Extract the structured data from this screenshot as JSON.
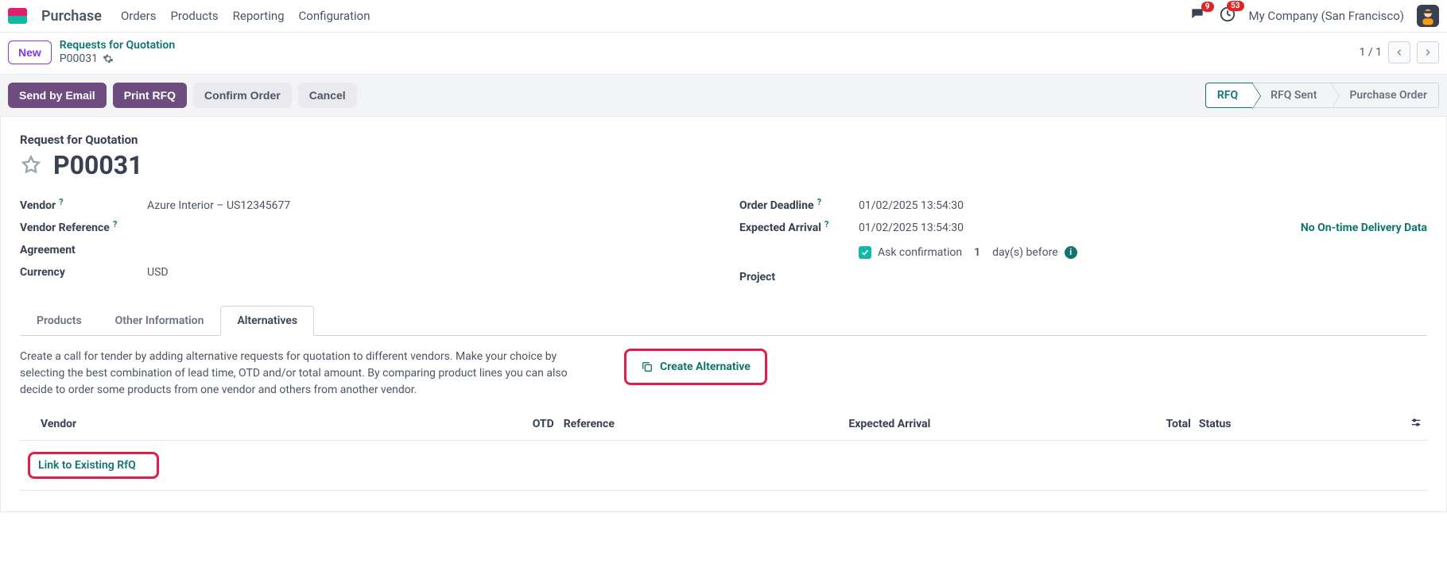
{
  "nav": {
    "app": "Purchase",
    "links": [
      "Orders",
      "Products",
      "Reporting",
      "Configuration"
    ],
    "messages_badge": "9",
    "activities_badge": "53",
    "company": "My Company (San Francisco)"
  },
  "crumbs": {
    "new": "New",
    "parent": "Requests for Quotation",
    "id": "P00031",
    "pager": "1 / 1"
  },
  "actions": {
    "send_email": "Send by Email",
    "print_rfq": "Print RFQ",
    "confirm": "Confirm Order",
    "cancel": "Cancel"
  },
  "status_steps": {
    "rfq": "RFQ",
    "rfq_sent": "RFQ Sent",
    "po": "Purchase Order"
  },
  "sheet": {
    "title_small": "Request for Quotation",
    "title": "P00031",
    "left": {
      "vendor_label": "Vendor",
      "vendor_value": "Azure Interior – US12345677",
      "vendor_ref_label": "Vendor Reference",
      "agreement_label": "Agreement",
      "currency_label": "Currency",
      "currency_value": "USD"
    },
    "right": {
      "deadline_label": "Order Deadline",
      "deadline_value": "01/02/2025 13:54:30",
      "arrival_label": "Expected Arrival",
      "arrival_value": "01/02/2025 13:54:30",
      "no_otd": "No On-time Delivery Data",
      "ask_confirm": "Ask confirmation",
      "ask_num": "1",
      "days_before": "day(s) before",
      "project_label": "Project"
    }
  },
  "tabs": {
    "products": "Products",
    "other": "Other Information",
    "alternatives": "Alternatives"
  },
  "alt": {
    "desc": "Create a call for tender by adding alternative requests for quotation to different vendors. Make your choice by selecting the best combination of lead time, OTD and/or total amount. By comparing product lines you can also decide to order some products from one vendor and others from another vendor.",
    "create": "Create Alternative",
    "cols": {
      "vendor": "Vendor",
      "otd": "OTD",
      "reference": "Reference",
      "expected": "Expected Arrival",
      "total": "Total",
      "status": "Status"
    },
    "link_existing": "Link to Existing RfQ"
  }
}
